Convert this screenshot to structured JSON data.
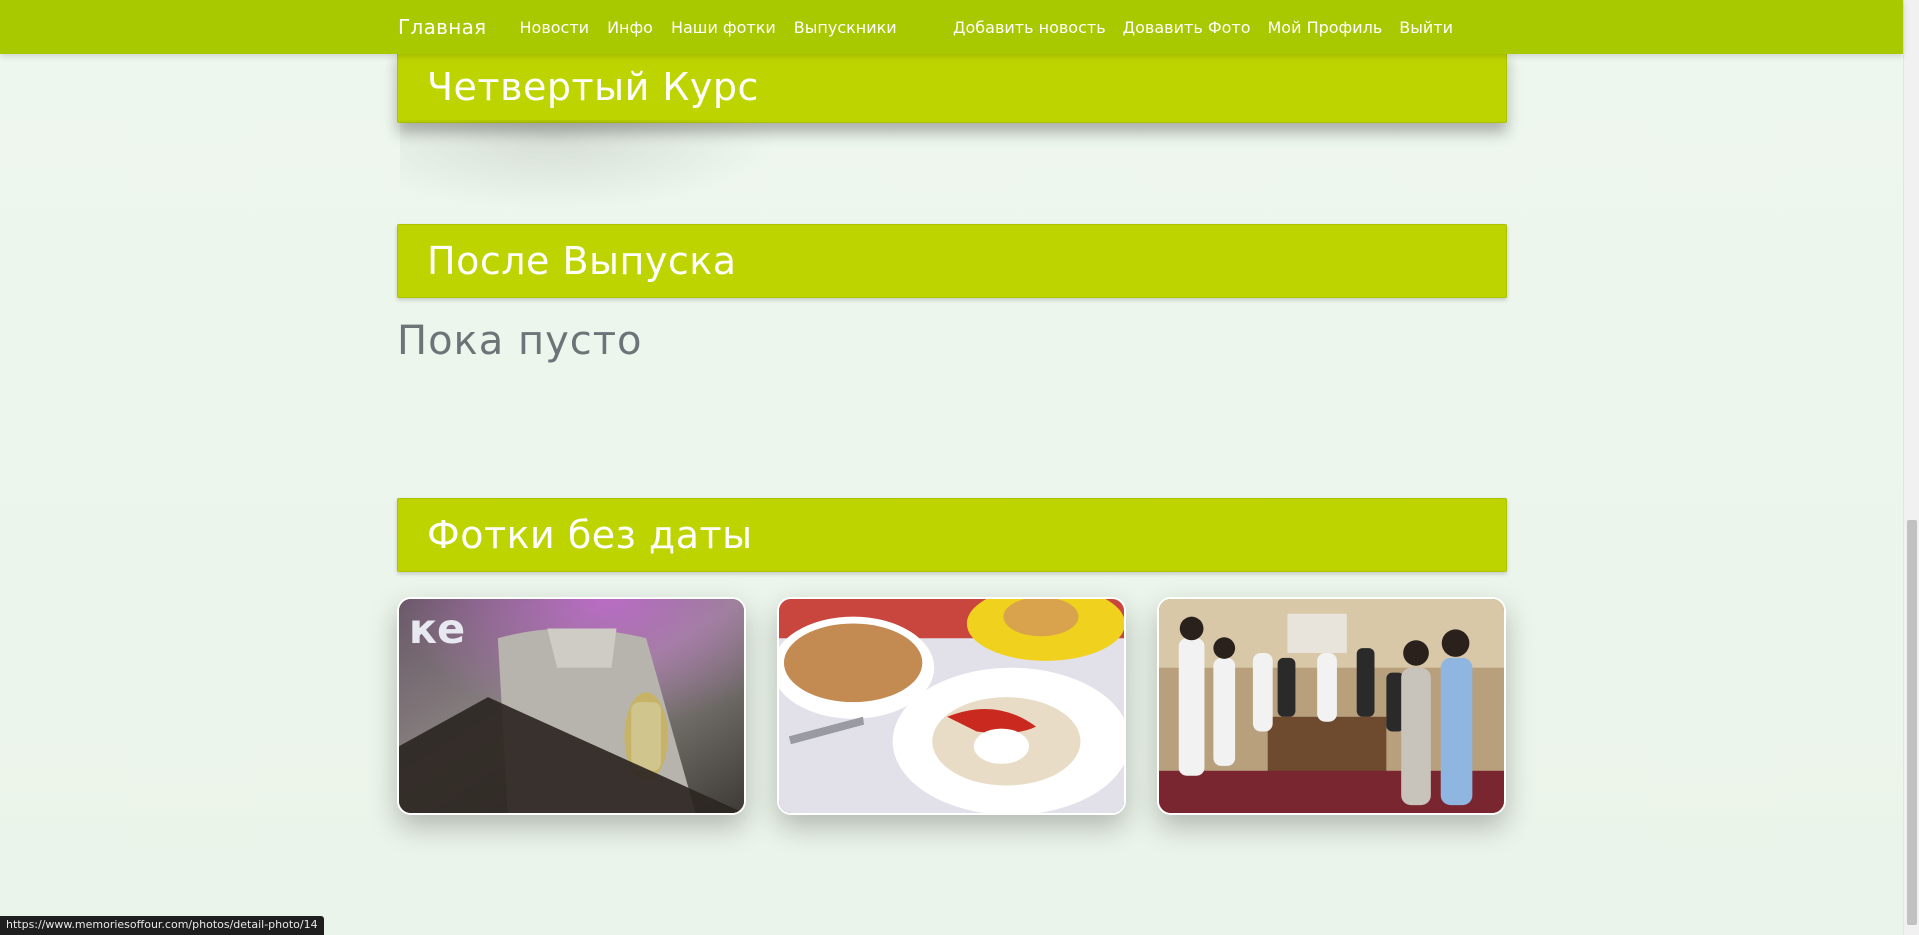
{
  "navbar": {
    "brand": "Главная",
    "links_left": [
      "Новости",
      "Инфо",
      "Наши фотки",
      "Выпускники"
    ],
    "links_right": [
      "Добавить новость",
      "Довавить Фото",
      "Мой Профиль",
      "Выйти"
    ],
    "color": "#a8c800"
  },
  "sections": [
    {
      "title": "Четвертый Курс"
    },
    {
      "title": "После Выпуска",
      "empty_text": "Пока пусто"
    },
    {
      "title": "Фотки без даты"
    }
  ],
  "photos": [
    {
      "description": "person-holding-glass"
    },
    {
      "description": "soup-and-dumplings"
    },
    {
      "description": "group-at-restaurant-table"
    }
  ],
  "status_bar": {
    "url": "https://www.memoriesoffour.com/photos/detail-photo/14"
  },
  "colors": {
    "accent": "#bed400",
    "navbar": "#a8c800",
    "background": "#eef6ee",
    "muted_text": "#6e7378"
  }
}
